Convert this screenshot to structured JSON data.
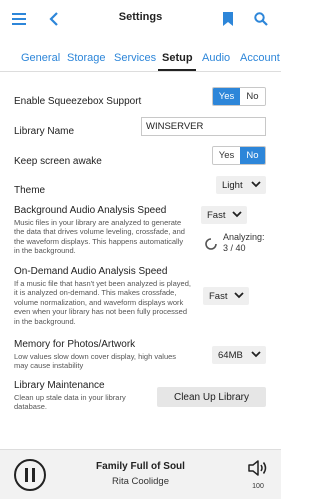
{
  "header": {
    "title": "Settings",
    "icons": [
      "menu-icon",
      "back-arrow-icon",
      "bookmark-icon",
      "search-icon"
    ],
    "accent_color": "#2d86d9"
  },
  "tabs": [
    {
      "label": "General",
      "active": false
    },
    {
      "label": "Storage",
      "active": false
    },
    {
      "label": "Services",
      "active": false
    },
    {
      "label": "Setup",
      "active": true
    },
    {
      "label": "Audio",
      "active": false
    },
    {
      "label": "Account",
      "active": false
    }
  ],
  "settings": {
    "squeezebox": {
      "label": "Enable Squeezebox Support",
      "yes": "Yes",
      "no": "No",
      "value": "Yes"
    },
    "library_name": {
      "label": "Library Name",
      "value": "WINSERVER"
    },
    "keep_awake": {
      "label": "Keep screen awake",
      "yes": "Yes",
      "no": "No",
      "value": "No"
    },
    "theme": {
      "label": "Theme",
      "value": "Light"
    },
    "bg_analysis": {
      "label": "Background Audio Analysis Speed",
      "description": "Music files in your library are analyzed to generate the data that drives volume leveling, crossfade, and the waveform displays. This happens automatically in the background.",
      "value": "Fast",
      "status_label": "Analyzing:",
      "status_progress": "3 / 40"
    },
    "od_analysis": {
      "label": "On-Demand Audio Analysis Speed",
      "description": "If a music file that hasn't yet been analyzed is played, it is analyzed on-demand. This makes crossfade, volume normalization, and waveform displays work even when your library has not been fully processed in the background.",
      "value": "Fast"
    },
    "photo_memory": {
      "label": "Memory for Photos/Artwork",
      "description": "Low values slow down cover display, high values may cause instability",
      "value": "64MB"
    },
    "maintenance": {
      "label": "Library Maintenance",
      "description": "Clean up stale data in your library database.",
      "button": "Clean Up Library"
    }
  },
  "player": {
    "title": "Family Full of Soul",
    "artist": "Rita Coolidge",
    "volume": "100"
  }
}
